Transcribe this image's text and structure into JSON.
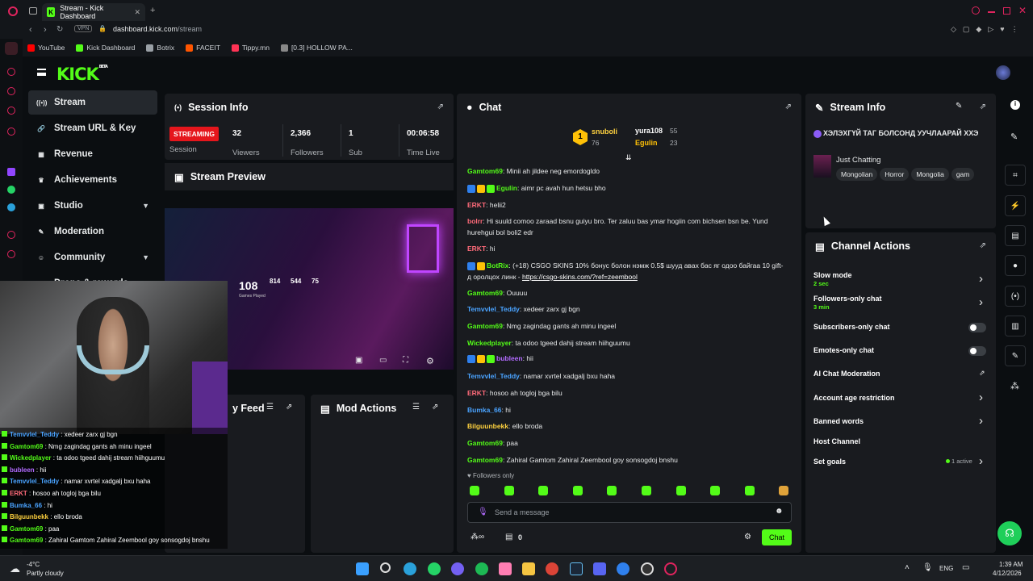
{
  "browser": {
    "tab_title": "Stream - Kick Dashboard",
    "url_host": "dashboard.kick.com",
    "url_path": "/stream",
    "vpn": "VPN"
  },
  "bookmarks": [
    {
      "label": "YouTube",
      "color": "#ff0000"
    },
    {
      "label": "Kick Dashboard",
      "color": "#53fc18"
    },
    {
      "label": "Botrix",
      "color": "#9aa0a6"
    },
    {
      "label": "FACEIT",
      "color": "#ff5500"
    },
    {
      "label": "Tippy.mn",
      "color": "#ff3355"
    },
    {
      "label": "[0.3] HOLLOW PA...",
      "color": "#888888"
    }
  ],
  "header": {
    "logo": "KICK",
    "beta": "BETA"
  },
  "sidebar": {
    "items": [
      {
        "label": "Stream",
        "icon": "broadcast-icon",
        "glyph": "((•))"
      },
      {
        "label": "Stream URL & Key",
        "icon": "link-icon",
        "glyph": "🔗"
      },
      {
        "label": "Revenue",
        "icon": "revenue-icon",
        "glyph": "▦"
      },
      {
        "label": "Achievements",
        "icon": "trophy-icon",
        "glyph": "♛"
      },
      {
        "label": "Studio",
        "icon": "studio-icon",
        "glyph": "▣"
      },
      {
        "label": "Moderation",
        "icon": "wrench-icon",
        "glyph": "✎"
      },
      {
        "label": "Community",
        "icon": "community-icon",
        "glyph": "☺"
      },
      {
        "label": "Drops & rewards",
        "icon": "gift-icon",
        "glyph": "▤"
      }
    ]
  },
  "session": {
    "title": "Session Info",
    "status": "STREAMING",
    "status_label": "Session",
    "stats": [
      {
        "value": "32",
        "label": "Viewers"
      },
      {
        "value": "2,366",
        "label": "Followers"
      },
      {
        "value": "1",
        "label": "Sub"
      },
      {
        "value": "00:06:58",
        "label": "Time Live"
      }
    ]
  },
  "preview": {
    "title": "Stream Preview",
    "big_number": "108",
    "big_label": "Games Played",
    "row_vals": [
      "814",
      "544",
      "75"
    ]
  },
  "activity": {
    "title": "y Feed"
  },
  "mod_actions": {
    "title": "Mod Actions"
  },
  "chat": {
    "title": "Chat",
    "top": [
      {
        "name": "snuboli",
        "count": "76",
        "rank": "1"
      },
      {
        "name": "yura108",
        "count": "55"
      },
      {
        "name": "Egulin",
        "count": "23"
      }
    ],
    "messages": [
      {
        "user": "Gamtom69",
        "color": "#53fc18",
        "text": "Minii ah jildee neg emordogldo"
      },
      {
        "user": "Egulin",
        "color": "#53fc18",
        "text": "aimr pc avah hun hetsu bho",
        "badges": 3
      },
      {
        "user": "ERKT",
        "color": "#ff6b7a",
        "text": "helii2"
      },
      {
        "user": "bolrr",
        "color": "#ff6b7a",
        "text": "Hi suuld comoo zaraad bsnu guiyu bro. Ter zaluu bas ymar hogiin com bichsen bsn be. Yund hurehgui bol boli2 edr"
      },
      {
        "user": "ERKT",
        "color": "#ff6b7a",
        "text": "hi"
      },
      {
        "user": "BotRix",
        "color": "#53fc18",
        "text": "(+18) CSGO SKINS 10% бонус болон нэмж 0.5$ шууд авах бас яг одоо байгаа 10 gift-д оролцох линк - ",
        "link": "https://csgo-skins.com/?ref=zeembool",
        "badges": 2
      },
      {
        "user": "Gamtom69",
        "color": "#53fc18",
        "text": "Ouuuu"
      },
      {
        "user": "Temvvlel_Teddy",
        "color": "#4aa3ff",
        "text": "xedeer zarx gj bgn"
      },
      {
        "user": "Gamtom69",
        "color": "#53fc18",
        "text": "Nmg zagindag gants ah minu ingeel"
      },
      {
        "user": "Wickedplayer",
        "color": "#53fc18",
        "text": "ta odoo tgeed dahij stream hiihguumu"
      },
      {
        "user": "bubleen",
        "color": "#b26bff",
        "text": "hii",
        "badges": 3
      },
      {
        "user": "Temvvlel_Teddy",
        "color": "#4aa3ff",
        "text": "namar xvrtel xadgalj bxu haha"
      },
      {
        "user": "ERKT",
        "color": "#ff6b7a",
        "text": "hosoo ah togloj bga bilu"
      },
      {
        "user": "Bumka_66",
        "color": "#4aa3ff",
        "text": "hi"
      },
      {
        "user": "Bilguunbekk",
        "color": "#ffd23f",
        "text": "ello broda"
      },
      {
        "user": "Gamtom69",
        "color": "#53fc18",
        "text": "paa"
      },
      {
        "user": "Gamtom69",
        "color": "#53fc18",
        "text": "Zahiral Gamtom Zahiral Zeembool goy sonsogdoj bnshu"
      }
    ],
    "followers_only": "Followers only",
    "placeholder": "Send a message",
    "points": "0",
    "send": "Chat"
  },
  "stream_info": {
    "title": "Stream Info",
    "stream_title": "ХЭЛЭХГҮЙ ТАГ БОЛСОНД УУЧЛААРАЙ ХХЭ",
    "category": "Just Chatting",
    "tags": [
      "Mongolian",
      "Horror",
      "Mongolia",
      "gam"
    ]
  },
  "channel_actions": {
    "title": "Channel Actions",
    "items": [
      {
        "label": "Slow mode",
        "sub": "2 sec",
        "control": "arrow"
      },
      {
        "label": "Followers-only chat",
        "sub": "3 min",
        "control": "arrow"
      },
      {
        "label": "Subscribers-only chat",
        "sub": "",
        "control": "toggle"
      },
      {
        "label": "Emotes-only chat",
        "sub": "",
        "control": "toggle"
      },
      {
        "label": "AI Chat Moderation",
        "sub": "",
        "control": "external"
      },
      {
        "label": "Account age restriction",
        "sub": "",
        "control": "arrow"
      },
      {
        "label": "Banned words",
        "sub": "",
        "control": "arrow"
      },
      {
        "label": "Host Channel",
        "sub": "",
        "control": "none"
      },
      {
        "label": "Set goals",
        "sub": "",
        "control": "arrow",
        "status": "1 active"
      }
    ]
  },
  "overlay_chat": [
    {
      "user": "Temvvlel_Teddy",
      "color": "#4aa3ff",
      "text": "xedeer zarx gj bgn"
    },
    {
      "user": "Gamtom69",
      "color": "#53fc18",
      "text": "Nmg zagindag gants ah minu ingeel"
    },
    {
      "user": "Wickedplayer",
      "color": "#53fc18",
      "text": "ta odoo tgeed dahij stream hiihguumu"
    },
    {
      "user": "bubleen",
      "color": "#b26bff",
      "text": "hii"
    },
    {
      "user": "Temvvlel_Teddy",
      "color": "#4aa3ff",
      "text": "namar xvrtel xadgalj bxu haha"
    },
    {
      "user": "ERKT",
      "color": "#ff6b7a",
      "text": "hosoo ah togloj bga bilu"
    },
    {
      "user": "Bumka_66",
      "color": "#4aa3ff",
      "text": "hi"
    },
    {
      "user": "Bilguunbekk",
      "color": "#ffd23f",
      "text": "ello broda"
    },
    {
      "user": "Gamtom69",
      "color": "#53fc18",
      "text": "paa"
    },
    {
      "user": "Gamtom69",
      "color": "#53fc18",
      "text": "Zahiral Gamtom Zahiral Zeembool goy sonsogdoj bnshu"
    }
  ],
  "taskbar": {
    "temp": "-4°C",
    "weather": "Partly cloudy",
    "lang": "ENG",
    "time": "1:39 AM",
    "date": "4/12/2026"
  }
}
